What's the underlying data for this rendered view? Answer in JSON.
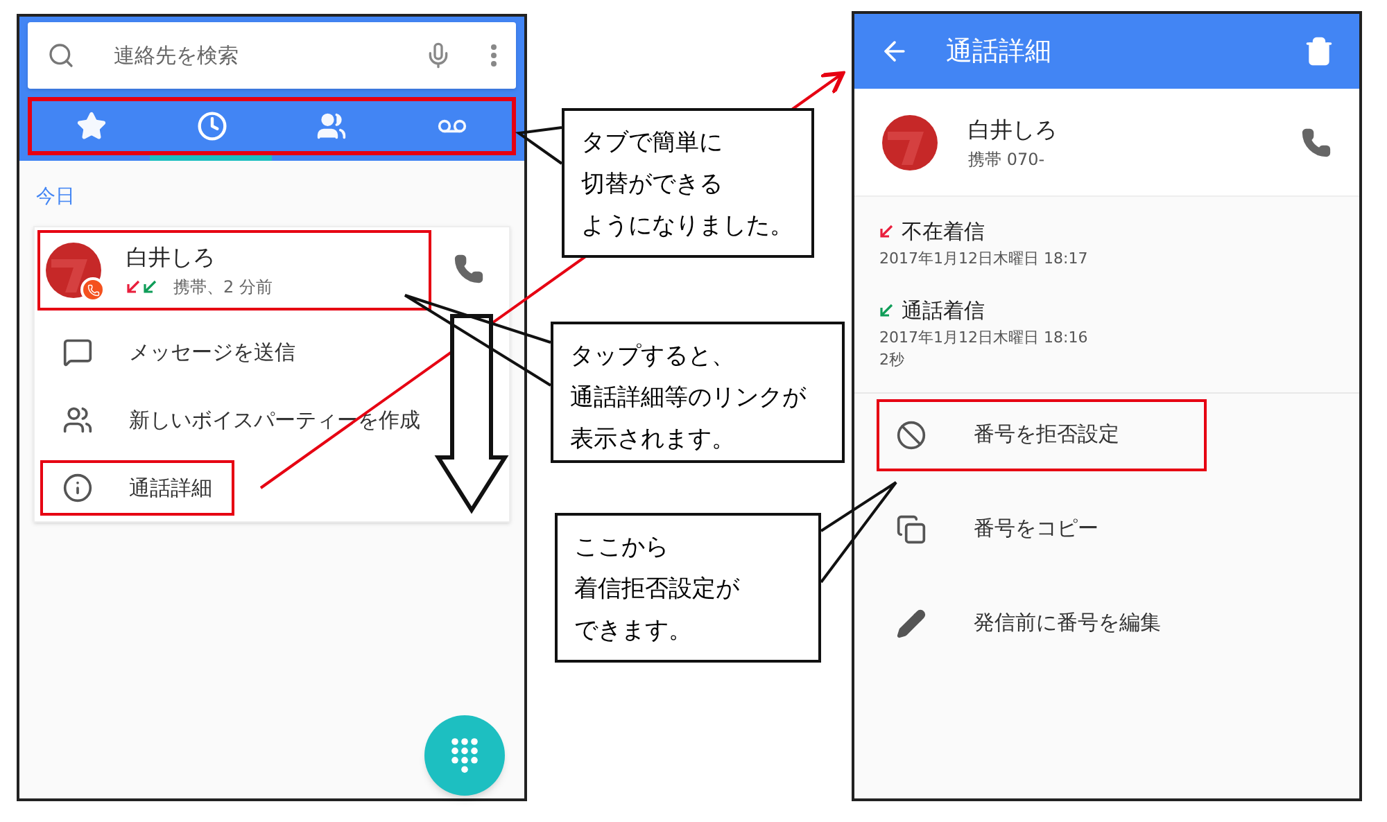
{
  "left_screen": {
    "search": {
      "placeholder": "連絡先を検索"
    },
    "tab_bar": {
      "highlighted": true,
      "tabs": [
        {
          "kind": "favorites",
          "selected": false
        },
        {
          "kind": "recents",
          "selected": true
        },
        {
          "kind": "contacts",
          "selected": false
        },
        {
          "kind": "voicemail",
          "selected": false
        }
      ]
    },
    "section_header": "今日",
    "contact": {
      "name": "白井しろ",
      "highlighted": true,
      "call_types": [
        {
          "kind": "missed"
        },
        {
          "kind": "incoming"
        }
      ],
      "detail": "携帯、2 分前"
    },
    "actions": [
      {
        "kind": "message",
        "label": "メッセージを送信",
        "highlighted": false
      },
      {
        "kind": "group",
        "label": "新しいボイスパーティーを作成",
        "highlighted": false
      },
      {
        "kind": "info",
        "label": "通話詳細",
        "highlighted": true
      }
    ]
  },
  "right_screen": {
    "title": "通話詳細",
    "contact": {
      "name": "白井しろ",
      "number": "携帯 070-"
    },
    "calls": [
      {
        "kind": "missed",
        "label": "不在着信",
        "time": "2017年1月12日木曜日 18:17"
      },
      {
        "kind": "incoming",
        "label": "通話着信",
        "time": "2017年1月12日木曜日 18:16",
        "duration": "2秒"
      }
    ],
    "actions": [
      {
        "kind": "block",
        "label": "番号を拒否設定",
        "highlighted": true
      },
      {
        "kind": "copy",
        "label": "番号をコピー",
        "highlighted": false
      },
      {
        "kind": "edit",
        "label": "発信前に番号を編集",
        "highlighted": false
      }
    ]
  },
  "callouts": [
    {
      "lines": [
        "タブで簡単に",
        "切替ができる",
        "ようになりました。"
      ]
    },
    {
      "lines": [
        "タップすると、",
        "通話詳細等のリンクが",
        "表示されます。"
      ]
    },
    {
      "lines": [
        "ここから",
        "着信拒否設定が",
        "できます。"
      ]
    }
  ]
}
